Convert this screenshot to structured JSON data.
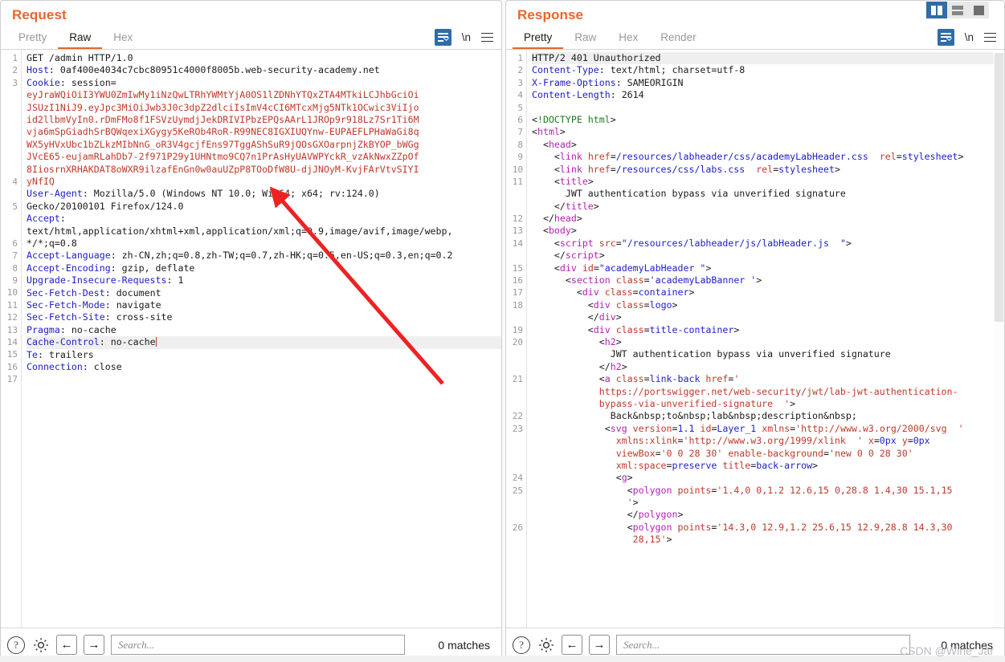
{
  "layout_toggles": [
    {
      "name": "side-by-side-layout",
      "active": true
    },
    {
      "name": "stacked-layout",
      "active": false
    },
    {
      "name": "single-pane-layout",
      "active": false
    }
  ],
  "request": {
    "title": "Request",
    "tabs": [
      {
        "label": "Pretty",
        "active": false
      },
      {
        "label": "Raw",
        "active": true
      },
      {
        "label": "Hex",
        "active": false
      }
    ],
    "tools": {
      "wrap_icon": "word-wrap-icon",
      "newline_label": "\\n",
      "menu_icon": "hamburger-menu-icon"
    },
    "lines": [
      {
        "n": 1,
        "type": "start",
        "text": "GET /admin HTTP/1.0"
      },
      {
        "n": 2,
        "type": "header",
        "name": "Host",
        "value": "0af400e4034c7cbc80951c4000f8005b.web-security-academy.net"
      },
      {
        "n": 3,
        "type": "cookie",
        "name": "Cookie",
        "value": "session=",
        "token": "eyJraWQiOiI3YWU0ZmIwMy1iNzQwLTRhYWMtYjA0OS1lZDNhYTQxZTA4MTkiLCJhbGciOiJSUzI1NiJ9.eyJpc3MiOiJwb3J0c3dpZ2dlciIsImV4cCI6MTcxMjg5NTk1OCwic3ViIjoid2llbmVyIn0.rDmFMo8f1FSVzUymdjJekDRIVIPbzEPQsAArL1JROp9r918Lz7Sr1Ti6Mvja6mSpGiadhSrBQWqexiXGygy5KeROb4RoR-R99NEC8IGXIUQYnw-EUPAEFLPHaWaGi8qWX5yHVxUbc1bZLkzMIbNnG_oR3V4gcjfEns97TggAShSuR9jQOsGXOarpnjZkBYOP_bWGgJVcE65-eujamRLahDb7-2f971P29y1UHNtmo9CQ7n1PrAsHyUAVWPYckR_vzAkNwxZZpOf8IiosrnXRHAKDAT8oWXR9ilzafEnGn0w0auUZpP8TOoDfW8U-djJNOyM-KvjFArVtvSIYIyNfIQ"
      },
      {
        "n": 4,
        "type": "header-wrap",
        "name": "User-Agent",
        "value": "Mozilla/5.0 (Windows NT 10.0; Win64; x64; rv:124.0)",
        "value2": "Gecko/20100101 Firefox/124.0"
      },
      {
        "n": 5,
        "type": "header-wrap3",
        "name": "Accept",
        "value": "",
        "value2": "text/html,application/xhtml+xml,application/xml;q=0.9,image/avif,image/webp,",
        "value3": "*/*;q=0.8"
      },
      {
        "n": 6,
        "type": "header",
        "name": "Accept-Language",
        "value": "zh-CN,zh;q=0.8,zh-TW;q=0.7,zh-HK;q=0.5,en-US;q=0.3,en;q=0.2"
      },
      {
        "n": 7,
        "type": "header",
        "name": "Accept-Encoding",
        "value": "gzip, deflate"
      },
      {
        "n": 8,
        "type": "header",
        "name": "Upgrade-Insecure-Requests",
        "value": "1"
      },
      {
        "n": 9,
        "type": "header",
        "name": "Sec-Fetch-Dest",
        "value": "document"
      },
      {
        "n": 10,
        "type": "header",
        "name": "Sec-Fetch-Mode",
        "value": "navigate"
      },
      {
        "n": 11,
        "type": "header",
        "name": "Sec-Fetch-Site",
        "value": "cross-site"
      },
      {
        "n": 12,
        "type": "header",
        "name": "Pragma",
        "value": "no-cache"
      },
      {
        "n": 13,
        "type": "header",
        "name": "Cache-Control",
        "value": "no-cache",
        "highlight": true,
        "caret": true
      },
      {
        "n": 14,
        "type": "header",
        "name": "Te",
        "value": "trailers"
      },
      {
        "n": 15,
        "type": "header",
        "name": "Connection",
        "value": "close"
      },
      {
        "n": 16,
        "type": "empty",
        "text": ""
      },
      {
        "n": 17,
        "type": "empty",
        "text": ""
      }
    ],
    "bottom": {
      "help_icon": "question-mark-icon",
      "settings_icon": "gear-icon",
      "prev_icon": "arrow-left-icon",
      "next_icon": "arrow-right-icon",
      "search_placeholder": "Search...",
      "search_value": "",
      "matches_label": "0 matches"
    }
  },
  "response": {
    "title": "Response",
    "tabs": [
      {
        "label": "Pretty",
        "active": true
      },
      {
        "label": "Raw",
        "active": false
      },
      {
        "label": "Hex",
        "active": false
      },
      {
        "label": "Render",
        "active": false
      }
    ],
    "tools": {
      "wrap_icon": "word-wrap-icon",
      "newline_label": "\\n",
      "menu_icon": "hamburger-menu-icon"
    },
    "status_line": "HTTP/2 401 Unauthorized",
    "headers": [
      {
        "n": 2,
        "name": "Content-Type",
        "value": "text/html; charset=utf-8"
      },
      {
        "n": 3,
        "name": "X-Frame-Options",
        "value": "SAMEORIGIN"
      },
      {
        "n": 4,
        "name": "Content-Length",
        "value": "2614"
      }
    ],
    "bottom": {
      "help_icon": "question-mark-icon",
      "settings_icon": "gear-icon",
      "prev_icon": "arrow-left-icon",
      "next_icon": "arrow-right-icon",
      "search_placeholder": "Search...",
      "search_value": "",
      "matches_label": "0 matches"
    }
  },
  "watermark": "CSDN @Wine_Jar",
  "colors": {
    "accent_orange": "#e8662a",
    "header_blue": "#2020c8",
    "jwt_red": "#c0392b",
    "tag_magenta": "#b31fb3",
    "attr_red": "#c0392b",
    "attrval_blue": "#2020c8",
    "doctype_green": "#1f7a1f",
    "active_toggle_blue": "#2f6ca8",
    "arrow_red": "#ee2222"
  }
}
